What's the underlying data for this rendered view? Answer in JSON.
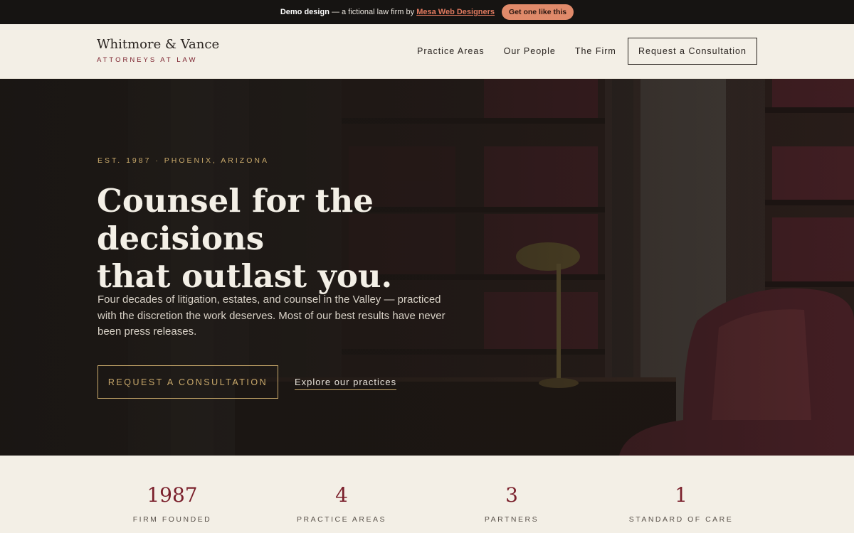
{
  "demo_banner": {
    "lead_bold": "Demo design",
    "lead_text": "— a fictional law firm by",
    "designer_link": "Mesa Web Designers",
    "cta": "Get one like this"
  },
  "header": {
    "brand_name": "Whitmore & Vance",
    "brand_tagline": "ATTORNEYS AT LAW",
    "nav": [
      "Practice Areas",
      "Our People",
      "The Firm"
    ],
    "cta": "Request a Consultation"
  },
  "hero": {
    "eyebrow": "EST. 1987 · PHOENIX, ARIZONA",
    "headline_line1": "Counsel for the decisions",
    "headline_line2": "that outlast you.",
    "lede": "Four decades of litigation, estates, and counsel in the Valley — practiced with the discretion the work deserves. Most of our best results have never been press releases.",
    "primary_cta": "REQUEST A CONSULTATION",
    "secondary_link": "Explore our practices"
  },
  "stats": [
    {
      "value": "1987",
      "label": "FIRM FOUNDED"
    },
    {
      "value": "4",
      "label": "PRACTICE AREAS"
    },
    {
      "value": "3",
      "label": "PARTNERS"
    },
    {
      "value": "1",
      "label": "STANDARD OF CARE"
    }
  ],
  "colors": {
    "accent_burgundy": "#7a1f2b",
    "accent_gold": "#c9a96b",
    "background_cream": "#f3efe6",
    "banner_dark": "#161412",
    "pill_salmon": "#e08a6a"
  }
}
